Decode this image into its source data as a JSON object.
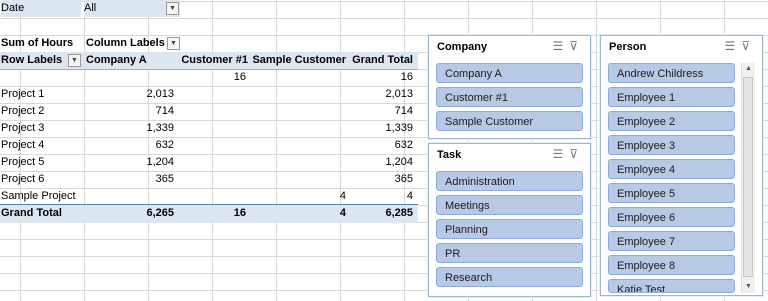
{
  "filter": {
    "field": "Date",
    "value": "All"
  },
  "pivot": {
    "measure": "Sum of Hours",
    "column_labels": "Column Labels",
    "row_labels": "Row Labels",
    "columns": [
      "Company A",
      "Customer #1",
      "Sample Customer",
      "Grand Total"
    ],
    "rows": [
      {
        "label": "",
        "values": [
          "",
          "16",
          "",
          "16"
        ]
      },
      {
        "label": "Project 1",
        "values": [
          "2,013",
          "",
          "",
          "2,013"
        ]
      },
      {
        "label": "Project 2",
        "values": [
          "714",
          "",
          "",
          "714"
        ]
      },
      {
        "label": "Project 3",
        "values": [
          "1,339",
          "",
          "",
          "1,339"
        ]
      },
      {
        "label": "Project 4",
        "values": [
          "632",
          "",
          "",
          "632"
        ]
      },
      {
        "label": "Project 5",
        "values": [
          "1,204",
          "",
          "",
          "1,204"
        ]
      },
      {
        "label": "Project 6",
        "values": [
          "365",
          "",
          "",
          "365"
        ]
      },
      {
        "label": "Sample Project",
        "values": [
          "",
          "",
          "4",
          "4"
        ]
      }
    ],
    "grand_total": {
      "label": "Grand Total",
      "values": [
        "6,265",
        "16",
        "4",
        "6,285"
      ]
    }
  },
  "slicers": {
    "company": {
      "title": "Company",
      "items": [
        "Company A",
        "Customer #1",
        "Sample Customer"
      ]
    },
    "task": {
      "title": "Task",
      "items": [
        "Administration",
        "Meetings",
        "Planning",
        "PR",
        "Research"
      ]
    },
    "person": {
      "title": "Person",
      "items": [
        "Andrew Childress",
        "Employee 1",
        "Employee 2",
        "Employee 3",
        "Employee 4",
        "Employee 5",
        "Employee 6",
        "Employee 7",
        "Employee 8",
        "Katie Test"
      ]
    }
  },
  "icons": {
    "multi_select": "multi-select-icon",
    "clear_filter": "clear-filter-icon",
    "dropdown": "chevron-down-icon"
  },
  "colors": {
    "header_fill": "#dce6f1",
    "slicer_item": "#b8c9e6",
    "slicer_border": "#9eb6ce"
  }
}
